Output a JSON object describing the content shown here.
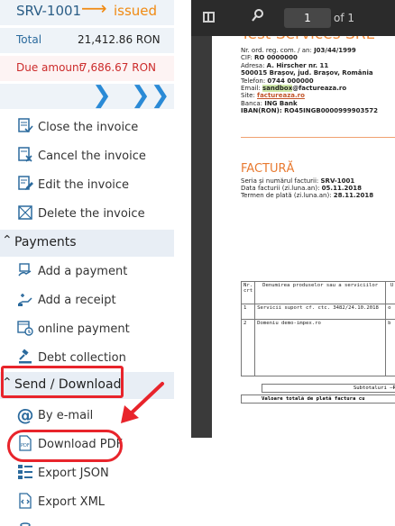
{
  "invoice": {
    "id": "SRV-1001",
    "arrow": "⟶",
    "status": "issued"
  },
  "totals": {
    "total_label": "Total",
    "total_value": "21,412.86 RON",
    "due_label": "Due amount",
    "due_value": "7,686.67 RON"
  },
  "nav": {
    "next": "❯",
    "last": "❯❯"
  },
  "actions": [
    {
      "label": "Close the invoice",
      "icon": "close-invoice-icon"
    },
    {
      "label": "Cancel the invoice",
      "icon": "cancel-invoice-icon"
    },
    {
      "label": "Edit the invoice",
      "icon": "edit-invoice-icon"
    },
    {
      "label": "Delete the invoice",
      "icon": "delete-invoice-icon"
    }
  ],
  "payments": {
    "title": "Payments",
    "items": [
      {
        "label": "Add a payment",
        "icon": "payment-icon"
      },
      {
        "label": "Add a receipt",
        "icon": "receipt-icon"
      },
      {
        "label": "online payment",
        "icon": "online-payment-icon"
      },
      {
        "label": "Debt collection",
        "icon": "gavel-icon"
      }
    ]
  },
  "send": {
    "title": "Send / Download",
    "items": [
      {
        "label": "By e-mail",
        "icon": "at-icon"
      },
      {
        "label": "Download PDF",
        "icon": "pdf-icon"
      },
      {
        "label": "Export JSON",
        "icon": "json-icon"
      },
      {
        "label": "Export XML",
        "icon": "xml-icon"
      }
    ]
  },
  "viewer": {
    "page": "1",
    "of": "of 1"
  },
  "doc": {
    "company": "Test Services SRL",
    "reg_label": "Nr. ord. reg. com. / an: ",
    "reg_value": "J03/44/1999",
    "cif_label": "CIF: ",
    "cif_value": "RO 0000000",
    "addr_label": "Adresa: ",
    "addr_value": "A. Hirscher nr. 11",
    "city": "500015 Brașov, jud. Brașov, România",
    "phone_label": "Telefon: ",
    "phone_value": "0744 000000",
    "email_label": "Email: ",
    "email_user": "sandbox",
    "email_domain": "@factureaza.ro",
    "site_label": "Site: ",
    "site_value": "factureaza.ro",
    "bank_label": "Banca: ",
    "bank_value": "ING Bank",
    "iban_label": "IBAN(RON): ",
    "iban_value": "RO45INGB0000999903572",
    "title": "FACTURĂ",
    "series_label": "Seria și numărul facturii: ",
    "series_value": "SRV-1001",
    "date_label": "Data facturii (zi.luna.an): ",
    "date_value": "05.11.2018",
    "due_label": "Termen de plată (zi.luna.an): ",
    "due_value": "28.11.2018",
    "table": {
      "col_nr": "Nr. crt",
      "col_name": "Denumirea produselor sau a serviciilor",
      "col_um": "U",
      "rows": [
        {
          "nr": "1",
          "name": "Servicii suport cf. ctc. 3482/24.10.2018",
          "um": "o"
        },
        {
          "nr": "2",
          "name": "Domeniu demo-impex.ro",
          "um": "b"
        }
      ]
    },
    "subtotal": "Subtotaluri –R",
    "grand_total": "Valoare totală de plată factura cu"
  }
}
